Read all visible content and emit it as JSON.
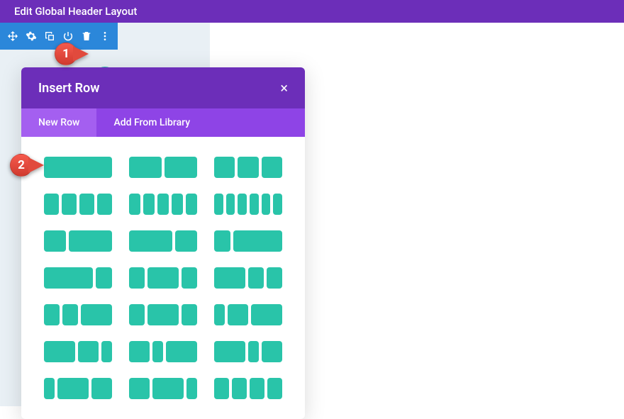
{
  "header": {
    "title": "Edit Global Header Layout"
  },
  "modal": {
    "title": "Insert Row",
    "close_label": "×",
    "tabs": [
      {
        "label": "New Row",
        "active": true
      },
      {
        "label": "Add From Library",
        "active": false
      }
    ]
  },
  "callouts": {
    "one": "1",
    "two": "2"
  },
  "layouts": [
    [
      [
        100
      ],
      [
        50,
        50
      ],
      [
        33.3,
        33.3,
        33.3
      ]
    ],
    [
      [
        25,
        25,
        25,
        25
      ],
      [
        20,
        20,
        20,
        20,
        20
      ],
      [
        16.6,
        16.6,
        16.6,
        16.6,
        16.6,
        16.6
      ]
    ],
    [
      [
        33.3,
        66.7
      ],
      [
        66.7,
        33.3
      ],
      [
        25,
        75
      ]
    ],
    [
      [
        75,
        25
      ],
      [
        25,
        50,
        25
      ],
      [
        50,
        25,
        25
      ]
    ],
    [
      [
        25,
        25,
        50
      ],
      [
        25,
        50,
        25
      ],
      [
        16.6,
        33.3,
        50
      ]
    ],
    [
      [
        50,
        33.3,
        16.6
      ],
      [
        33.3,
        16.6,
        50
      ],
      [
        50,
        16.6,
        33.3
      ]
    ],
    [
      [
        16.6,
        50,
        33.3
      ],
      [
        33.3,
        50,
        16.6
      ],
      [
        25,
        25,
        25,
        25
      ]
    ]
  ]
}
